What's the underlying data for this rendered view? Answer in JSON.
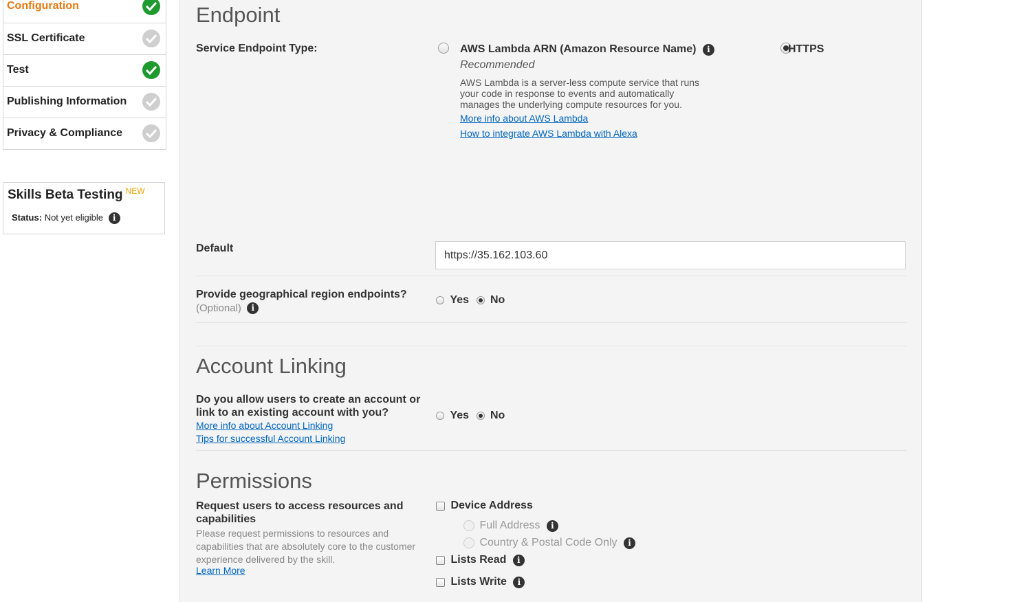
{
  "sidebar": {
    "items": [
      {
        "label": "Configuration",
        "status": "complete",
        "active": true
      },
      {
        "label": "SSL Certificate",
        "status": "incomplete",
        "active": false
      },
      {
        "label": "Test",
        "status": "complete",
        "active": false
      },
      {
        "label": "Publishing Information",
        "status": "incomplete",
        "active": false
      },
      {
        "label": "Privacy & Compliance",
        "status": "incomplete",
        "active": false
      }
    ],
    "beta": {
      "title": "Skills Beta Testing",
      "badge": "NEW",
      "status_label": "Status:",
      "status_value": "Not yet eligible"
    }
  },
  "endpoint": {
    "title": "Endpoint",
    "type_label": "Service Endpoint Type:",
    "lambda_option": "AWS Lambda ARN (Amazon Resource Name)",
    "recommended": "Recommended",
    "lambda_desc_1": "AWS Lambda is a server-less compute service that runs",
    "lambda_desc_2": "your code in response to events and automatically",
    "lambda_desc_3": "manages the underlying compute resources for you.",
    "lambda_link_1": "More info about AWS Lambda",
    "lambda_link_2": "How to integrate AWS Lambda with Alexa",
    "https_option": "HTTPS",
    "selected": "HTTPS",
    "default_label": "Default",
    "default_value": "https://35.162.103.60",
    "geo_label": "Provide geographical region endpoints?",
    "geo_optional": "(Optional)",
    "geo_yes": "Yes",
    "geo_no": "No",
    "geo_selected": "No"
  },
  "account_linking": {
    "title": "Account Linking",
    "question_1": "Do you allow users to create an account or",
    "question_2": "link to an existing account with you?",
    "link_1": "More info about Account Linking",
    "link_2": "Tips for successful Account Linking",
    "yes": "Yes",
    "no": "No",
    "selected": "No"
  },
  "permissions": {
    "title": "Permissions",
    "request_1": "Request users to access resources and",
    "request_2": "capabilities",
    "desc_1": "Please request permissions to resources and",
    "desc_2": "capabilities that are absolutely core to the customer",
    "desc_3": "experience delivered by the skill.",
    "learn_more": "Learn More",
    "device_address": "Device Address",
    "full_address": "Full Address",
    "country_postal": "Country & Postal Code Only",
    "lists_read": "Lists Read",
    "lists_write": "Lists Write"
  }
}
